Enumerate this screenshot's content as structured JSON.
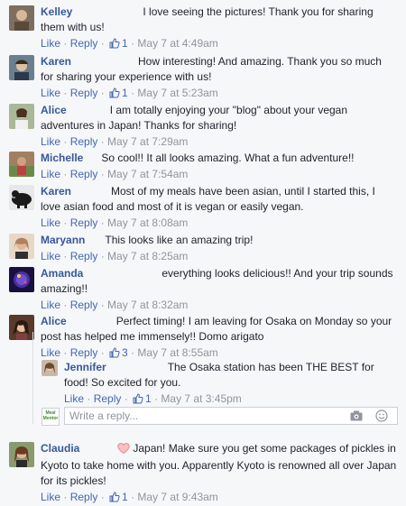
{
  "comments": [
    {
      "name": "Kelley",
      "text": "I love seeing the pictures! Thank you for sharing them with us!",
      "like": "Like",
      "reply": "Reply",
      "likes": "1",
      "time": "May 7 at 4:49am",
      "avatar_color": "#8a7a6a"
    },
    {
      "name": "Karen",
      "text": "How interesting! And amazing. Thank you so much for sharing your experience with us!",
      "like": "Like",
      "reply": "Reply",
      "likes": "1",
      "time": "May 7 at 5:23am",
      "avatar_color": "#6b7f8f"
    },
    {
      "name": "Alice",
      "text": "I am totally enjoying your \"blog\" about your vegan adventures in Japan! Thanks for sharing!",
      "like": "Like",
      "reply": "Reply",
      "likes": "",
      "time": "May 7 at 7:29am",
      "avatar_color": "#9aa58a"
    },
    {
      "name": "Michelle",
      "text": "So cool!! It all looks amazing. What a fun adventure!!",
      "like": "Like",
      "reply": "Reply",
      "likes": "",
      "time": "May 7 at 7:54am",
      "avatar_color": "#a08060"
    },
    {
      "name": "Karen",
      "text": "Most of my meals have been asian, until I started this, I love asian food and most of it is vegan or easily vegan.",
      "like": "Like",
      "reply": "Reply",
      "likes": "",
      "time": "May 7 at 8:08am",
      "avatar_color": "#3a3a3a"
    },
    {
      "name": "Maryann",
      "text": "This looks like an amazing trip!",
      "like": "Like",
      "reply": "Reply",
      "likes": "",
      "time": "May 7 at 8:25am",
      "avatar_color": "#c09070"
    },
    {
      "name": "Amanda",
      "text": "everything looks delicious!! And your trip sounds amazing!!",
      "like": "Like",
      "reply": "Reply",
      "likes": "",
      "time": "May 7 at 8:32am",
      "avatar_color": "#3a2a6a"
    },
    {
      "name": "Alice",
      "text": "Perfect timing! I am leaving for Osaka on Monday so your post has helped me immensely!! Domo arigato",
      "like": "Like",
      "reply": "Reply",
      "likes": "3",
      "time": "May 7 at 8:55am",
      "avatar_color": "#5a3a2a"
    },
    {
      "name": "Jennifer",
      "text": "The Osaka station has been THE BEST for food! So excited for you.",
      "like": "Like",
      "reply": "Reply",
      "likes": "1",
      "time": "May 7 at 3:45pm",
      "avatar_color": "#b0a090"
    },
    {
      "name": "Claudia",
      "text": "Japan! Make sure you get some packages of pickles in Kyoto to take home with you. Apparently Kyoto is renowned all over Japan for its pickles!",
      "like": "Like",
      "reply": "Reply",
      "likes": "1",
      "time": "May 7 at 9:43am",
      "avatar_color": "#8a6a50"
    }
  ],
  "composer": {
    "placeholder": "Write a reply...",
    "avatar_text": "Meal Mentor"
  },
  "colors": {
    "name": "#365899",
    "link": "#4267b2",
    "meta": "#90949c",
    "heart": "#e9898f"
  }
}
